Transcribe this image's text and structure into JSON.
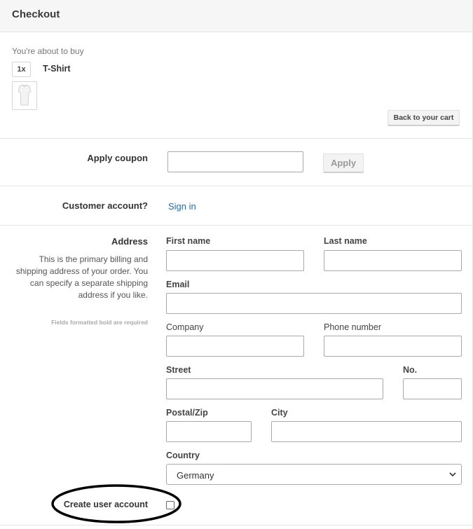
{
  "header": {
    "title": "Checkout"
  },
  "summary": {
    "intro": "You're about to buy",
    "items": [
      {
        "qty": "1x",
        "name": "T-Shirt",
        "image": "tshirt-thumbnail"
      }
    ],
    "back_label": "Back to your cart"
  },
  "coupon": {
    "label": "Apply coupon",
    "value": "",
    "apply_label": "Apply"
  },
  "account": {
    "label": "Customer account?",
    "signin_label": "Sign in"
  },
  "address": {
    "label": "Address",
    "description": [
      "This is the primary billing and",
      "shipping address of your order. You",
      "can specify a separate shipping",
      "address if you like."
    ],
    "required_note": "Fields formatted bold are required",
    "fields": {
      "first_name": {
        "label": "First name",
        "value": ""
      },
      "last_name": {
        "label": "Last name",
        "value": ""
      },
      "email": {
        "label": "Email",
        "value": ""
      },
      "company": {
        "label": "Company",
        "value": ""
      },
      "phone": {
        "label": "Phone number",
        "value": ""
      },
      "street": {
        "label": "Street",
        "value": ""
      },
      "number": {
        "label": "No.",
        "value": ""
      },
      "postal": {
        "label": "Postal/Zip",
        "value": ""
      },
      "city": {
        "label": "City",
        "value": ""
      },
      "country": {
        "label": "Country",
        "value": "Germany"
      }
    }
  },
  "create_account": {
    "label": "Create user account",
    "checked": false
  },
  "colors": {
    "link": "#2a6aa3",
    "header_bg": "#f6f6f6",
    "annotation": "#000000"
  }
}
